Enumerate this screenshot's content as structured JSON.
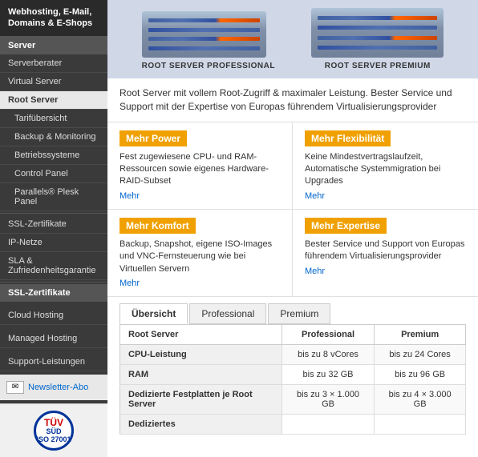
{
  "sidebar": {
    "header": "Webhosting, E-Mail, Domains & E-Shops",
    "sections": [
      {
        "title": "Server",
        "items": [
          {
            "label": "Serverberater",
            "active": false,
            "sub": false
          },
          {
            "label": "Virtual Server",
            "active": false,
            "sub": false
          },
          {
            "label": "Root Server",
            "active": true,
            "sub": false
          },
          {
            "label": "Tarifübersicht",
            "active": false,
            "sub": true
          },
          {
            "label": "Backup & Monitoring",
            "active": false,
            "sub": true
          },
          {
            "label": "Betriebssysteme",
            "active": false,
            "sub": true
          },
          {
            "label": "Control Panel",
            "active": false,
            "sub": true
          },
          {
            "label": "Parallels® Plesk Panel",
            "active": false,
            "sub": true
          }
        ]
      }
    ],
    "ssl_label": "SSL-Zertifikate",
    "ip_label": "IP-Netze",
    "sla_label": "SLA & Zufriedenheitsgarantie",
    "ssl_zertifikate_label": "SSL-Zertifikate",
    "cloud_hosting_label": "Cloud Hosting",
    "managed_hosting_label": "Managed Hosting",
    "support_label": "Support-Leistungen",
    "newsletter_link": "Newsletter-Abo",
    "tuev_line1": "TÜV",
    "tuev_line2": "SÜD",
    "tuev_line3": "ISO 27001"
  },
  "main": {
    "server1": {
      "label": "ROOT SERVER PROFESSIONAL"
    },
    "server2": {
      "label": "ROOT SERVER PREMIUM"
    },
    "description": "Root Server mit vollem Root-Zugriff & maximaler Leistung. Bester Service und Support mit der Expertise von Europas führendem Virtualisierungsprovider",
    "features": [
      {
        "title": "Mehr Power",
        "text": "Fest zugewiesene CPU- und RAM-Ressourcen sowie eigenes Hardware-RAID-Subset",
        "more": "Mehr"
      },
      {
        "title": "Mehr Flexibilität",
        "text": "Keine Mindestvertragslaufzeit, Automatische Systemmigration bei Upgrades",
        "more": "Mehr"
      },
      {
        "title": "Mehr Komfort",
        "text": "Backup, Snapshot, eigene ISO-Images und VNC-Fernsteuerung wie bei Virtuellen Servern",
        "more": "Mehr"
      },
      {
        "title": "Mehr Expertise",
        "text": "Bester Service und Support von Europas führendem Virtualisierungsprovider",
        "more": "Mehr"
      }
    ],
    "tabs": [
      {
        "label": "Übersicht",
        "active": true
      },
      {
        "label": "Professional",
        "active": false
      },
      {
        "label": "Premium",
        "active": false
      }
    ],
    "table": {
      "headers": [
        "Root Server",
        "Professional",
        "Premium"
      ],
      "rows": [
        {
          "label": "CPU-Leistung",
          "professional": "bis zu 8 vCores",
          "premium": "bis zu 24 Cores"
        },
        {
          "label": "RAM",
          "professional": "bis zu 32 GB",
          "premium": "bis zu 96 GB"
        },
        {
          "label": "Dedizierte Festplatten je Root Server",
          "professional": "bis zu 3 × 1.000 GB",
          "premium": "bis zu 4 × 3.000 GB"
        },
        {
          "label": "Dediziertes",
          "professional": "",
          "premium": ""
        }
      ]
    }
  }
}
